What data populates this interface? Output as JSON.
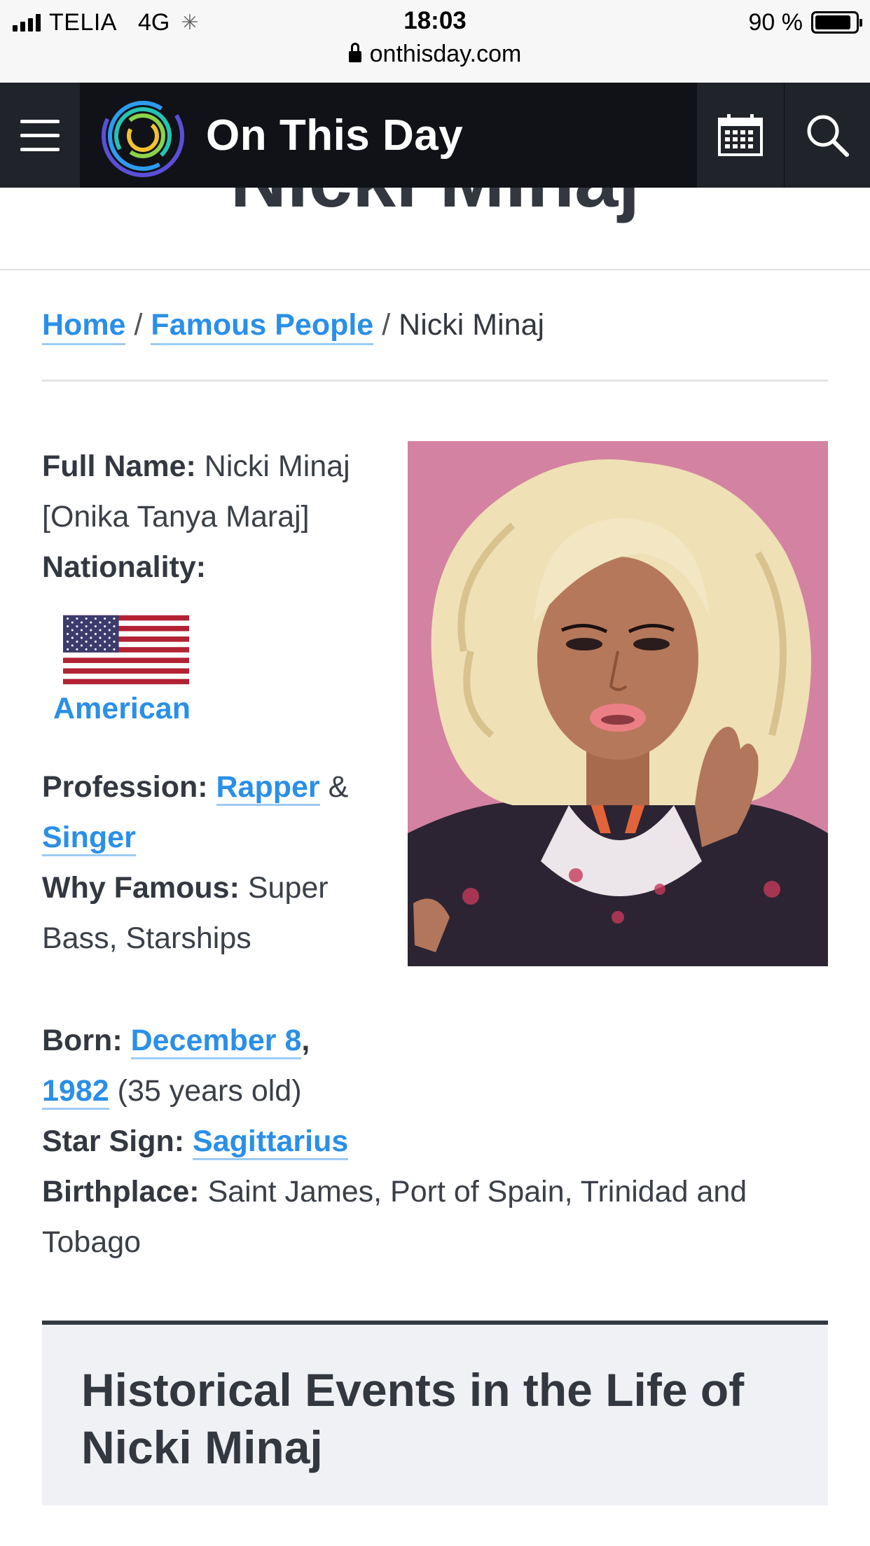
{
  "status_bar": {
    "carrier": "TELIA",
    "network": "4G",
    "time": "18:03",
    "battery_percent": "90 %",
    "battery_level": 0.9,
    "url": "onthisday.com"
  },
  "header": {
    "site_name": "On This Day",
    "icons": [
      "hamburger-menu-icon",
      "on-this-day-logo",
      "calendar-icon",
      "search-icon"
    ]
  },
  "page": {
    "title": "Nicki Minaj"
  },
  "breadcrumb": {
    "home": "Home",
    "separator": "/",
    "famous_people": "Famous People",
    "current": "Nicki Minaj"
  },
  "person": {
    "full_name_label": "Full Name:",
    "full_name": "Nicki Minaj [Onika Tanya Maraj]",
    "nationality_label": "Nationality:",
    "nationality": "American",
    "profession_label": "Profession:",
    "profession_1": "Rapper",
    "profession_joiner": "&",
    "profession_2": "Singer",
    "why_famous_label": "Why Famous:",
    "why_famous": "Super Bass, Starships",
    "born_label": "Born:",
    "born_date": "December 8",
    "born_comma": ",",
    "born_year": "1982",
    "age": "(35 years old)",
    "star_sign_label": "Star Sign:",
    "star_sign": "Sagittarius",
    "birthplace_label": "Birthplace:",
    "birthplace": "Saint James, Port of Spain, Trinidad and Tobago"
  },
  "events": {
    "title": "Historical Events in the Life of Nicki Minaj"
  },
  "colors": {
    "link": "#2a8fe8",
    "header_bg": "#101217",
    "header_btn_bg": "#202329",
    "text": "#333840",
    "events_bg": "#f0f1f5"
  }
}
